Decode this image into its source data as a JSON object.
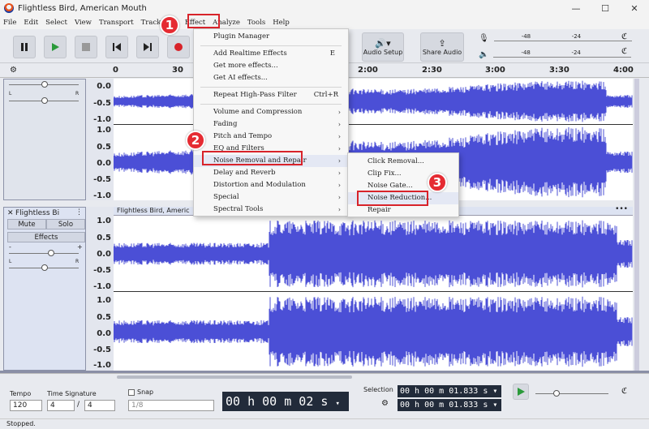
{
  "window": {
    "title": "Flightless Bird, American Mouth",
    "minimize": "—",
    "maximize": "☐",
    "close": "✕"
  },
  "menubar": [
    "File",
    "Edit",
    "Select",
    "View",
    "Transport",
    "Tracks",
    "Effect",
    "Analyze",
    "Tools",
    "Help"
  ],
  "toolbar": {
    "audio_setup": "Audio Setup",
    "share_audio": "Share Audio",
    "meter_ticks": [
      "-48",
      "-24",
      "-48",
      "-24"
    ]
  },
  "timeline": {
    "ticks": [
      "0",
      "30",
      "2:00",
      "2:30",
      "3:00",
      "3:30",
      "4:00"
    ]
  },
  "track1": {
    "scale_top": [
      "0.0",
      "-0.5",
      "-1.0"
    ],
    "scale_bottom": [
      "1.0",
      "0.5",
      "0.0",
      "-0.5",
      "-1.0"
    ],
    "pan_left": "L",
    "pan_right": "R"
  },
  "track2": {
    "name": "Flightless Bi",
    "mute": "Mute",
    "solo": "Solo",
    "effects": "Effects",
    "clip_title": "Flightless Bird, Americ",
    "gain_minus": "-",
    "gain_plus": "+",
    "pan_left": "L",
    "pan_right": "R",
    "scale_top": [
      "1.0",
      "0.5",
      "0.0",
      "-0.5",
      "-1.0"
    ],
    "scale_bottom": [
      "1.0",
      "0.5",
      "0.0",
      "-0.5",
      "-1.0"
    ]
  },
  "effect_menu": {
    "items": [
      {
        "label": "Plugin Manager",
        "shortcut": "",
        "submenu": false
      },
      {
        "label": "Add Realtime Effects",
        "shortcut": "E",
        "submenu": false
      },
      {
        "label": "Get more effects...",
        "shortcut": "",
        "submenu": false
      },
      {
        "label": "Get AI effects...",
        "shortcut": "",
        "submenu": false
      },
      {
        "label": "Repeat High-Pass Filter",
        "shortcut": "Ctrl+R",
        "submenu": false
      },
      {
        "label": "Volume and Compression",
        "shortcut": "",
        "submenu": true
      },
      {
        "label": "Fading",
        "shortcut": "",
        "submenu": true
      },
      {
        "label": "Pitch and Tempo",
        "shortcut": "",
        "submenu": true
      },
      {
        "label": "EQ and Filters",
        "shortcut": "",
        "submenu": true
      },
      {
        "label": "Noise Removal and Repair",
        "shortcut": "",
        "submenu": true
      },
      {
        "label": "Delay and Reverb",
        "shortcut": "",
        "submenu": true
      },
      {
        "label": "Distortion and Modulation",
        "shortcut": "",
        "submenu": true
      },
      {
        "label": "Special",
        "shortcut": "",
        "submenu": true
      },
      {
        "label": "Spectral Tools",
        "shortcut": "",
        "submenu": true
      }
    ]
  },
  "noise_submenu": {
    "items": [
      "Click Removal...",
      "Clip Fix...",
      "Noise Gate...",
      "Noise Reduction...",
      "Repair"
    ]
  },
  "badges": [
    "1",
    "2",
    "3"
  ],
  "bottom": {
    "tempo_label": "Tempo",
    "tempo_value": "120",
    "timesig_label": "Time Signature",
    "timesig_num": "4",
    "timesig_slash": "/",
    "timesig_den": "4",
    "snap_label": "Snap",
    "snap_value": "1/8",
    "time_display": "00 h 00 m 02 s",
    "selection_label": "Selection",
    "selection_start": "00 h 00 m 01.833 s",
    "selection_end": "00 h 00 m 01.833 s"
  },
  "status": "Stopped.",
  "colors": {
    "wave": "#4b4fd6",
    "accent_red": "#d8232a",
    "selected_bg": "#dde3f2"
  }
}
